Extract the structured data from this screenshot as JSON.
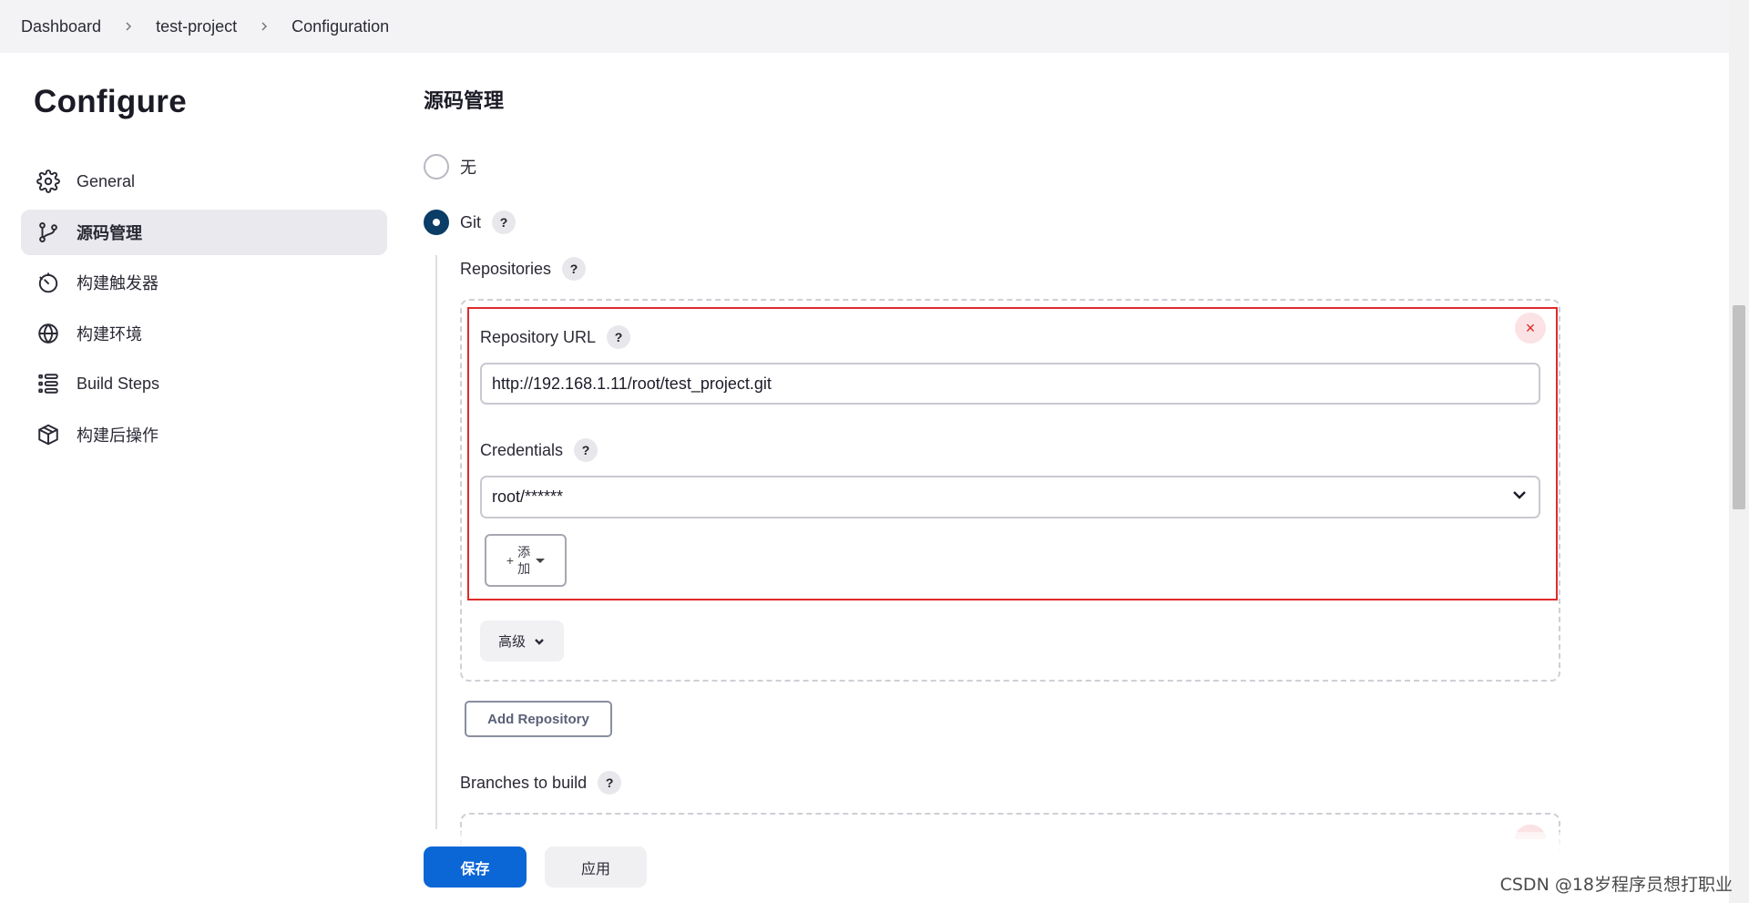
{
  "breadcrumb": [
    "Dashboard",
    "test-project",
    "Configuration"
  ],
  "sidebar": {
    "title": "Configure",
    "items": [
      {
        "label": "General",
        "icon": "gear-icon"
      },
      {
        "label": "源码管理",
        "icon": "branch-icon",
        "active": true
      },
      {
        "label": "构建触发器",
        "icon": "timer-icon"
      },
      {
        "label": "构建环境",
        "icon": "globe-icon"
      },
      {
        "label": "Build Steps",
        "icon": "list-icon"
      },
      {
        "label": "构建后操作",
        "icon": "package-icon"
      }
    ]
  },
  "scm": {
    "section_title": "源码管理",
    "option_none": "无",
    "option_git": "Git",
    "help": "?",
    "repositories_label": "Repositories",
    "repository_url_label": "Repository URL",
    "repository_url_value": "http://192.168.1.11/root/test_project.git",
    "credentials_label": "Credentials",
    "credentials_value": "root/******",
    "add_button_plus": "+",
    "add_button_line1": "添",
    "add_button_line2": "加",
    "advanced_label": "高级",
    "add_repository_label": "Add Repository",
    "branches_label": "Branches to build",
    "remove_icon": "×"
  },
  "actions": {
    "save": "保存",
    "apply": "应用"
  },
  "watermark": "CSDN @18岁程序员想打职业",
  "colors": {
    "accent": "#0b66d6",
    "radio_checked": "#0b3d66",
    "highlight": "#e02a2a"
  }
}
